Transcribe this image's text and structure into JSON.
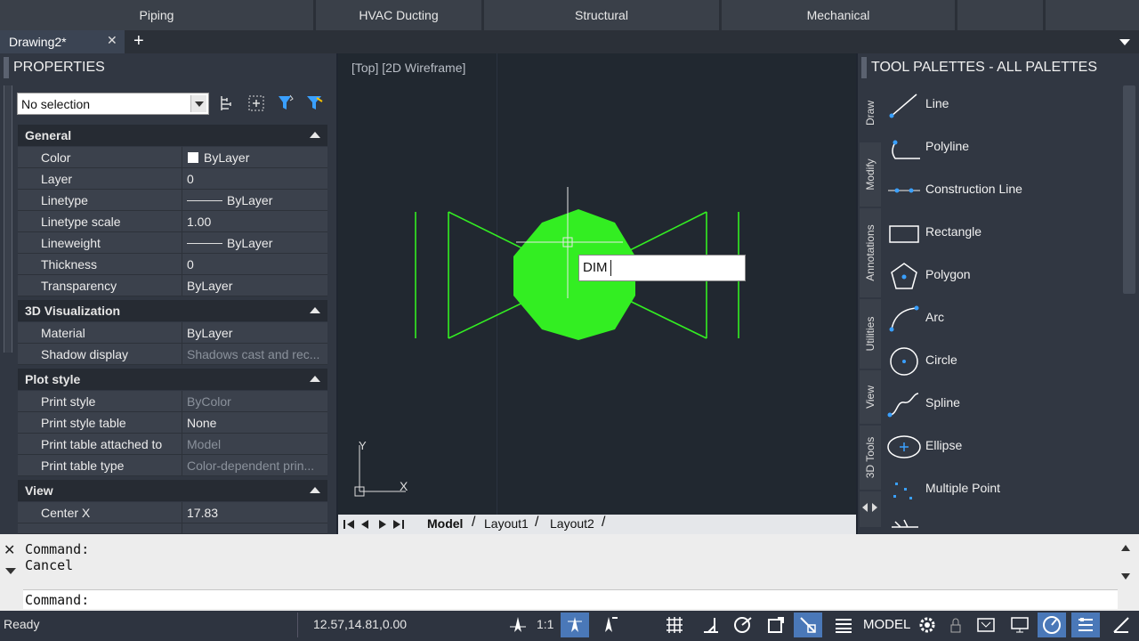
{
  "ribbon": {
    "tabs": [
      "Piping",
      "HVAC Ducting",
      "Structural",
      "Mechanical"
    ]
  },
  "document": {
    "tab_label": "Drawing2*",
    "close": "✕",
    "add": "+"
  },
  "properties": {
    "title": "PROPERTIES",
    "selection": "No selection",
    "sections": {
      "general": "General",
      "viz": "3D Visualization",
      "plot": "Plot style",
      "view": "View"
    },
    "rows": {
      "color": {
        "key": "Color",
        "value": "ByLayer"
      },
      "layer": {
        "key": "Layer",
        "value": "0"
      },
      "linetype": {
        "key": "Linetype",
        "value": "ByLayer"
      },
      "linetype_scale": {
        "key": "Linetype scale",
        "value": "1.00"
      },
      "lineweight": {
        "key": "Lineweight",
        "value": "ByLayer"
      },
      "thickness": {
        "key": "Thickness",
        "value": "0"
      },
      "transparency": {
        "key": "Transparency",
        "value": "ByLayer"
      },
      "material": {
        "key": "Material",
        "value": "ByLayer"
      },
      "shadow": {
        "key": "Shadow display",
        "value": "Shadows cast and rec..."
      },
      "print_style": {
        "key": "Print style",
        "value": "ByColor"
      },
      "print_style_table": {
        "key": "Print style table",
        "value": "None"
      },
      "print_table_attached": {
        "key": "Print table attached to",
        "value": "Model"
      },
      "print_table_type": {
        "key": "Print table type",
        "value": "Color-dependent prin..."
      },
      "center_x": {
        "key": "Center X",
        "value": "17.83"
      }
    }
  },
  "viewport": {
    "label": "[Top] [2D Wireframe]",
    "dynamic_input": "DIM",
    "ucs_y": "Y",
    "ucs_x": "X",
    "drawing_color": "#33ee22"
  },
  "layouts": {
    "tabs": [
      "Model",
      "Layout1",
      "Layout2"
    ]
  },
  "palette": {
    "title": "TOOL PALETTES - ALL PALETTES",
    "side_tabs": [
      "Draw",
      "Modify",
      "Annotations",
      "Utilities",
      "View",
      "3D Tools"
    ],
    "tools": [
      "Line",
      "Polyline",
      "Construction Line",
      "Rectangle",
      "Polygon",
      "Arc",
      "Circle",
      "Spline",
      "Ellipse",
      "Multiple Point"
    ]
  },
  "command": {
    "history": "Command:\nCancel",
    "prompt": "Command:"
  },
  "status": {
    "ready": "Ready",
    "coords": "12.57,14.81,0.00",
    "scale": "1:1",
    "model": "MODEL"
  },
  "colors": {
    "accent": "#4a78b8",
    "filter": "#3aa0ff"
  }
}
